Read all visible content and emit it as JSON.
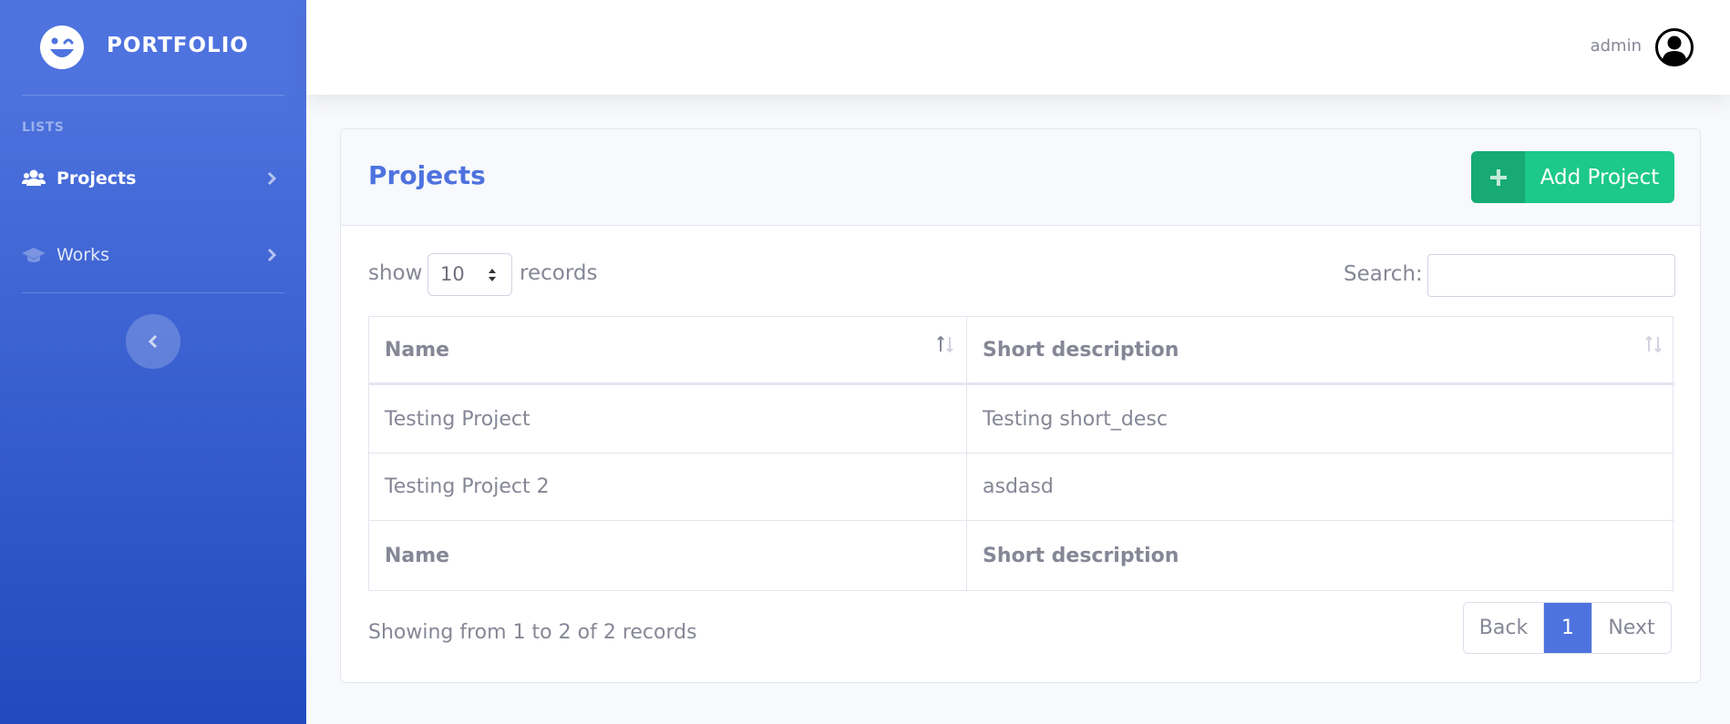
{
  "brand": {
    "name": "PORTFOLIO",
    "logo_icon": "laugh-wink-icon"
  },
  "sidebar": {
    "heading": "LISTS",
    "items": [
      {
        "label": "Projects",
        "icon": "users-icon",
        "active": true
      },
      {
        "label": "Works",
        "icon": "graduation-cap-icon",
        "active": false
      }
    ],
    "toggle_icon": "chevron-left-icon"
  },
  "topbar": {
    "user_name": "admin",
    "avatar_icon": "user-circle-icon"
  },
  "page": {
    "title": "Projects",
    "add_button_label": "Add Project",
    "length": {
      "prefix": "show",
      "value": "10",
      "suffix": "records"
    },
    "search": {
      "label": "Search:",
      "value": ""
    },
    "table": {
      "columns": [
        "Name",
        "Short description"
      ],
      "rows": [
        [
          "Testing Project",
          "Testing short_desc"
        ],
        [
          "Testing Project 2",
          "asdasd"
        ]
      ],
      "footer": [
        "Name",
        "Short description"
      ]
    },
    "info": "Showing from 1 to 2 of 2 records",
    "pagination": {
      "back": "Back",
      "current": "1",
      "next": "Next"
    }
  },
  "colors": {
    "primary": "#4e73df",
    "success": "#1cc88a",
    "text": "#858796"
  }
}
